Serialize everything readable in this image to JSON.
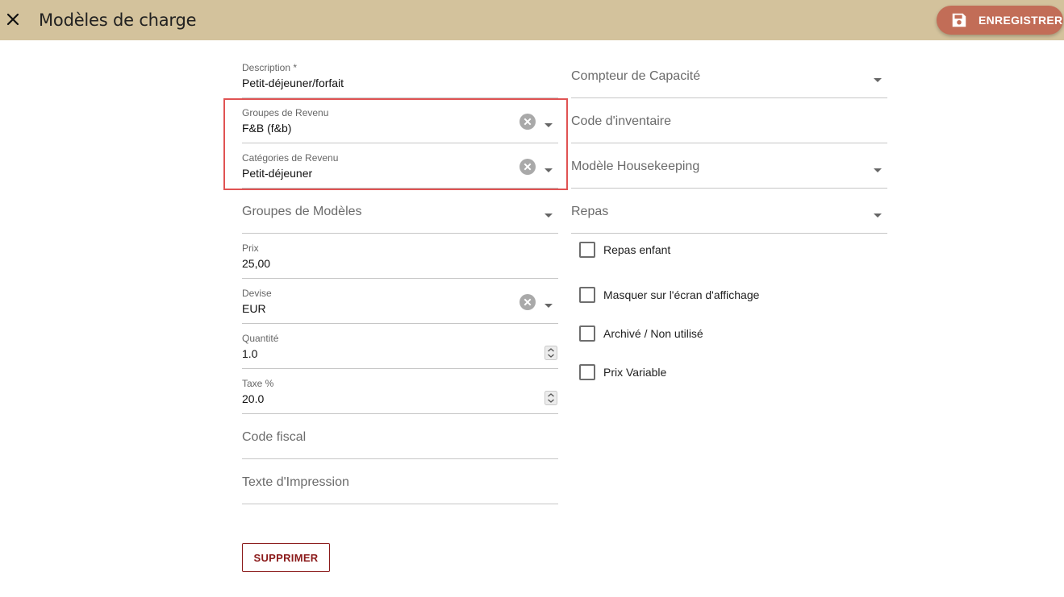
{
  "header": {
    "title": "Modèles de charge",
    "save_label": "ENREGISTRER",
    "close_icon": "close-icon",
    "save_icon": "floppy-disk-icon",
    "background": "#d3c29c",
    "save_color": "#c26d57"
  },
  "left": {
    "description": {
      "label": "Description *",
      "value": "Petit-déjeuner/forfait"
    },
    "revenue_groups": {
      "label": "Groupes de Revenu",
      "value": "F&B (f&b)"
    },
    "revenue_categories": {
      "label": "Catégories de Revenu",
      "value": "Petit-déjeuner"
    },
    "model_groups": {
      "placeholder": "Groupes de Modèles"
    },
    "price": {
      "label": "Prix",
      "value": "25,00"
    },
    "currency": {
      "label": "Devise",
      "value": "EUR"
    },
    "quantity": {
      "label": "Quantité",
      "value": "1.0"
    },
    "tax": {
      "label": "Taxe %",
      "value": "20.0"
    },
    "fiscal_code": {
      "placeholder": "Code fiscal"
    },
    "print_text": {
      "placeholder": "Texte d'Impression"
    }
  },
  "right": {
    "capacity_counter": {
      "placeholder": "Compteur de Capacité"
    },
    "inventory_code": {
      "placeholder": "Code d'inventaire"
    },
    "housekeeping_model": {
      "placeholder": "Modèle Housekeeping"
    },
    "meals": {
      "placeholder": "Repas"
    },
    "checkboxes": [
      {
        "label": "Repas enfant",
        "checked": false
      },
      {
        "label": "Masquer sur l'écran d'affichage",
        "checked": false
      },
      {
        "label": "Archivé / Non utilisé",
        "checked": false
      },
      {
        "label": "Prix Variable",
        "checked": false
      }
    ]
  },
  "delete_label": "SUPPRIMER",
  "highlight_color": "#e05353"
}
